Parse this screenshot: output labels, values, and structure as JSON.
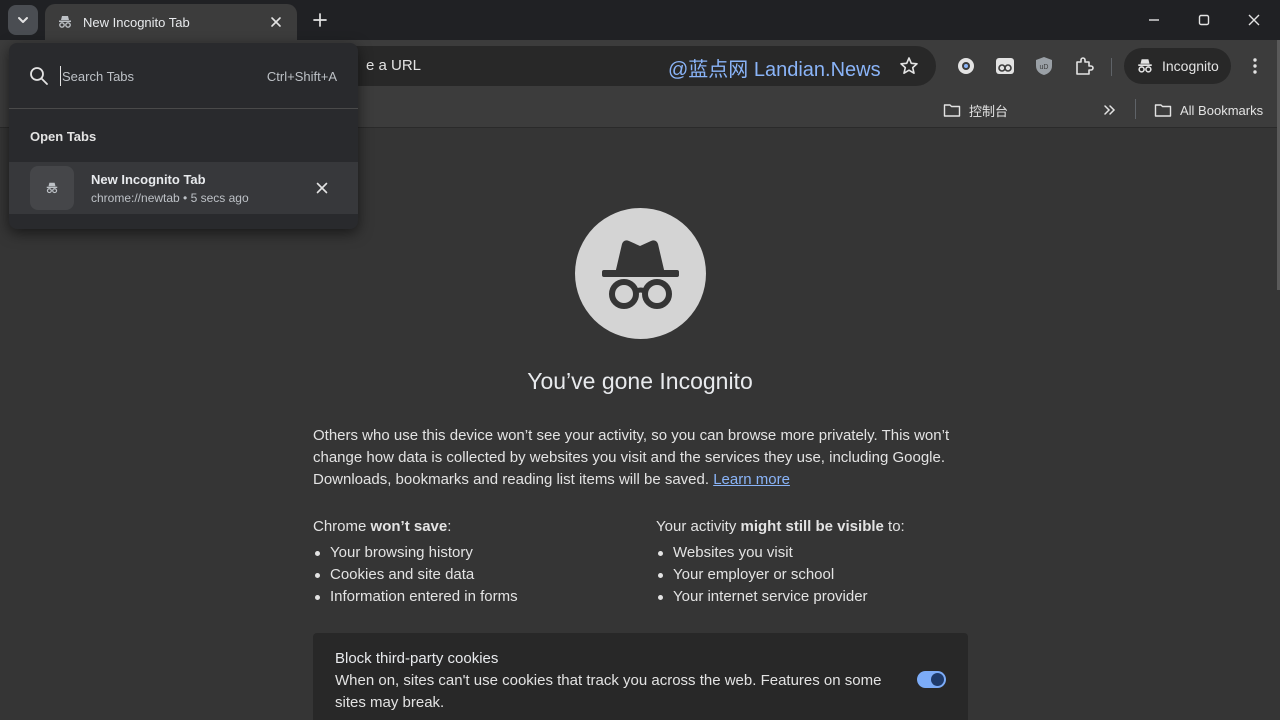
{
  "tabstrip": {
    "tab_title": "New Incognito Tab",
    "new_tab_icon": "plus-icon",
    "tab_search_icon": "chevron-down-icon"
  },
  "window_controls": [
    "minimize-icon",
    "maximize-icon",
    "close-icon"
  ],
  "toolbar": {
    "omnibox_text": "e a URL",
    "watermark": "@蓝点网 Landian.News",
    "extensions": [
      "extension-icon-1",
      "extension-icon-2",
      "ublock-icon",
      "puzzle-icon"
    ],
    "incognito_label": "Incognito"
  },
  "bookmarks": {
    "folder_label": "控制台",
    "all_bookmarks_label": "All Bookmarks"
  },
  "tab_search": {
    "placeholder": "Search Tabs",
    "shortcut": "Ctrl+Shift+A",
    "section_label": "Open Tabs",
    "items": [
      {
        "title": "New Incognito Tab",
        "subtitle": "chrome://newtab • 5 secs ago"
      }
    ]
  },
  "ntp": {
    "title": "You’ve gone Incognito",
    "desc": "Others who use this device won’t see your activity, so you can browse more privately. This won’t change how data is collected by websites you visit and the services they use, including Google. Downloads, bookmarks and reading list items will be saved.",
    "learn_more": "Learn more",
    "left_head_a": "Chrome ",
    "left_head_b": "won’t save",
    "left_head_c": ":",
    "left_items": [
      "Your browsing history",
      "Cookies and site data",
      "Information entered in forms"
    ],
    "right_head_a": "Your activity ",
    "right_head_b": "might still be visible",
    "right_head_c": " to:",
    "right_items": [
      "Websites you visit",
      "Your employer or school",
      "Your internet service provider"
    ],
    "cookie_title": "Block third-party cookies",
    "cookie_desc": "When on, sites can't use cookies that track you across the web. Features on some sites may break.",
    "cookie_toggle_on": true
  },
  "colors": {
    "accent": "#8ab4f8",
    "background": "#353535",
    "toolbar": "#3c3c3c"
  }
}
